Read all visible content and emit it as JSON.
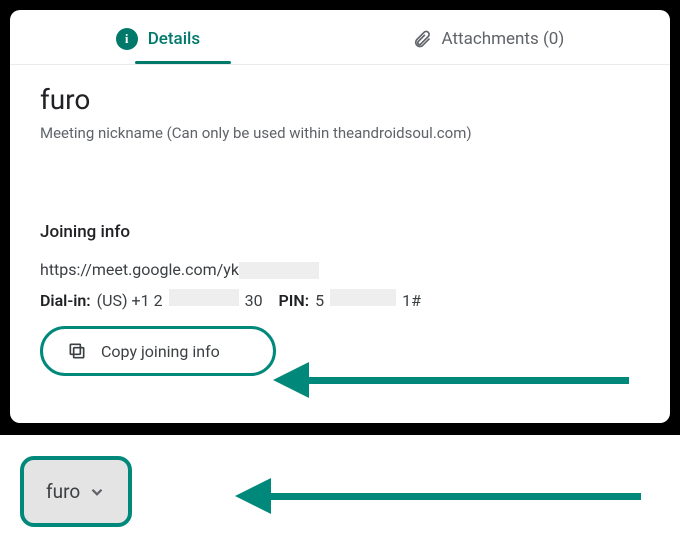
{
  "tabs": {
    "details": "Details",
    "attachments_label": "Attachments (0)"
  },
  "meeting": {
    "nickname": "furo",
    "nickname_subtitle": "Meeting nickname (Can only be used within theandroidsoul.com)"
  },
  "joining": {
    "title": "Joining info",
    "link_visible": "https://meet.google.com/yk",
    "dial_label": "Dial-in:",
    "dial_prefix": "(US) +1 2",
    "dial_suffix": "30",
    "pin_label": "PIN:",
    "pin_prefix": "5",
    "pin_suffix": "1#"
  },
  "buttons": {
    "copy": "Copy joining info"
  },
  "footer": {
    "pill_label": "furo"
  },
  "colors": {
    "accent": "#00796b",
    "highlight": "#00897b"
  }
}
